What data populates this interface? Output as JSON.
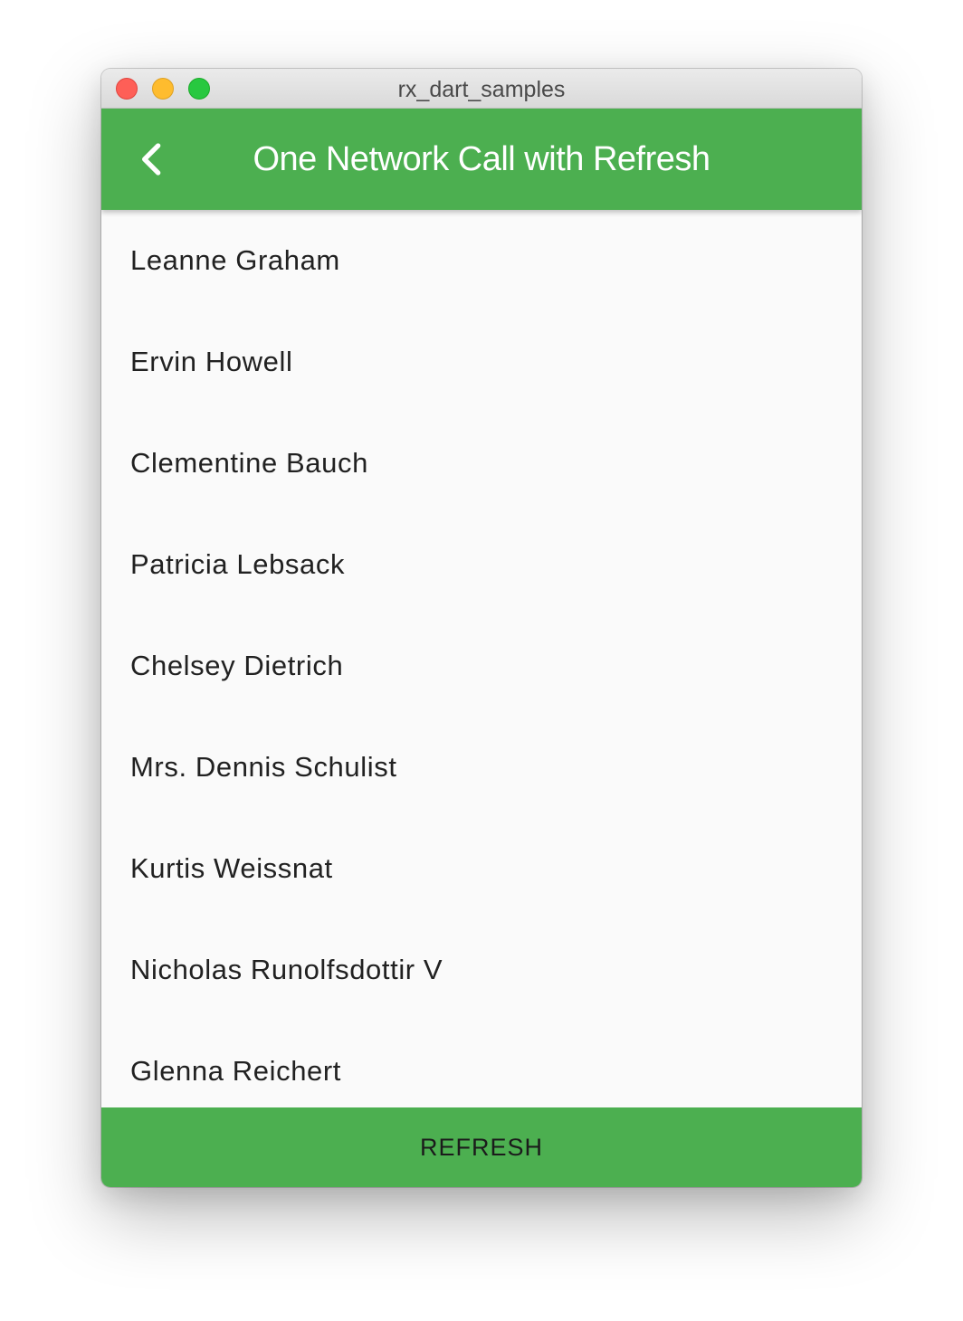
{
  "window": {
    "title": "rx_dart_samples"
  },
  "appbar": {
    "title": "One Network Call with Refresh",
    "back_icon": "chevron-left-icon",
    "color": "#4caf50"
  },
  "users": [
    {
      "name": "Leanne Graham"
    },
    {
      "name": "Ervin Howell"
    },
    {
      "name": "Clementine Bauch"
    },
    {
      "name": "Patricia Lebsack"
    },
    {
      "name": "Chelsey Dietrich"
    },
    {
      "name": "Mrs. Dennis Schulist"
    },
    {
      "name": "Kurtis Weissnat"
    },
    {
      "name": "Nicholas Runolfsdottir V"
    },
    {
      "name": "Glenna Reichert"
    }
  ],
  "footer": {
    "refresh_label": "REFRESH"
  }
}
